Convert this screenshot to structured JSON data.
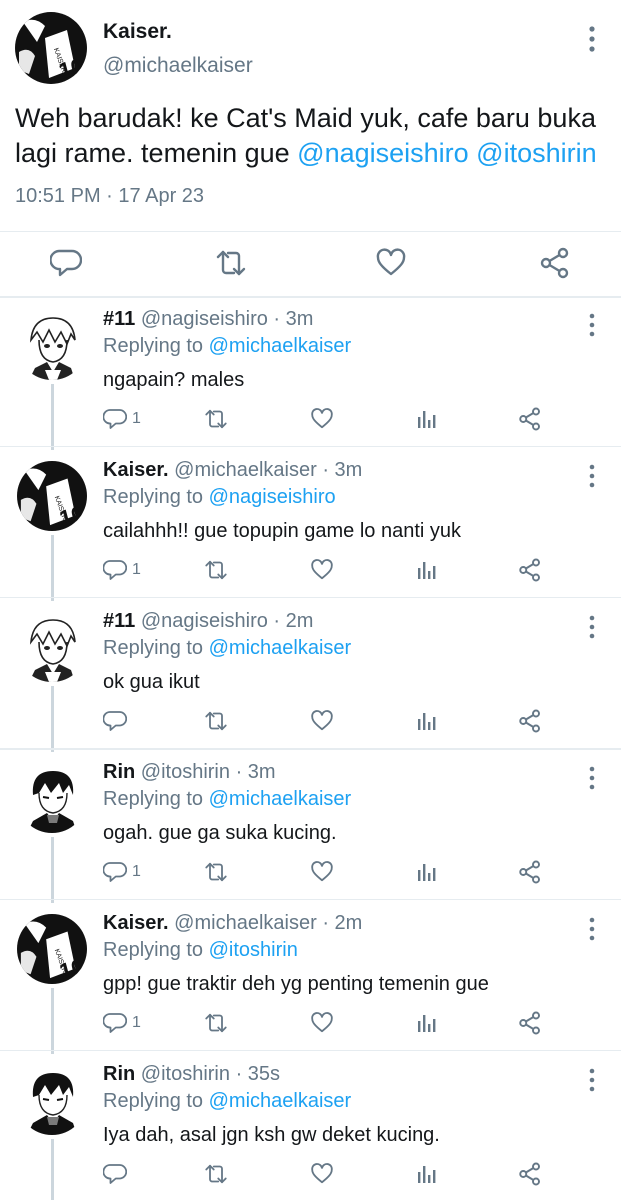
{
  "main_tweet": {
    "display_name": "Kaiser.",
    "handle": "@michaelkaiser",
    "text_parts": [
      "Weh barudak! ke Cat's Maid yuk, cafe baru buka lagi rame. temenin gue ",
      "@nagiseishiro",
      " ",
      "@itoshirin"
    ],
    "time": "10:51 PM",
    "separator": "·",
    "date": "17 Apr 23",
    "icons": {
      "reply": "reply-icon",
      "retweet": "retweet-icon",
      "like": "heart-icon",
      "share": "share-icon",
      "more": "more-vertical-icon"
    }
  },
  "colors": {
    "mention": "#1da1f2",
    "secondary": "#657786",
    "divider": "#e6ecf0",
    "thread": "#ccd6dd"
  },
  "replies": [
    {
      "display_name": "#11",
      "handle": "@nagiseishiro",
      "separator": "·",
      "age": "3m",
      "replying_label": "Replying to",
      "replying_to": "@michaelkaiser",
      "text": "ngapain? males",
      "reply_count": "1",
      "avatar": "nagi-avatar"
    },
    {
      "display_name": "Kaiser.",
      "handle": "@michaelkaiser",
      "separator": "·",
      "age": "3m",
      "replying_label": "Replying to",
      "replying_to": "@nagiseishiro",
      "text": "cailahhh!! gue topupin game lo nanti yuk",
      "reply_count": "1",
      "avatar": "kaiser-avatar"
    },
    {
      "display_name": "#11",
      "handle": "@nagiseishiro",
      "separator": "·",
      "age": "2m",
      "replying_label": "Replying to",
      "replying_to": "@michaelkaiser",
      "text": "ok gua ikut",
      "reply_count": "",
      "avatar": "nagi-avatar"
    },
    {
      "display_name": "Rin",
      "handle": "@itoshirin",
      "separator": "·",
      "age": "3m",
      "replying_label": "Replying to",
      "replying_to": "@michaelkaiser",
      "text": "ogah. gue ga suka kucing.",
      "reply_count": "1",
      "avatar": "rin-avatar"
    },
    {
      "display_name": "Kaiser.",
      "handle": "@michaelkaiser",
      "separator": "·",
      "age": "2m",
      "replying_label": "Replying to",
      "replying_to": "@itoshirin",
      "text": "gpp! gue traktir deh yg penting temenin gue",
      "reply_count": "1",
      "avatar": "kaiser-avatar"
    },
    {
      "display_name": "Rin",
      "handle": "@itoshirin",
      "separator": "·",
      "age": "35s",
      "replying_label": "Replying to",
      "replying_to": "@michaelkaiser",
      "text": "Iya dah, asal jgn ksh gw deket kucing.",
      "reply_count": "",
      "avatar": "rin-avatar"
    }
  ]
}
